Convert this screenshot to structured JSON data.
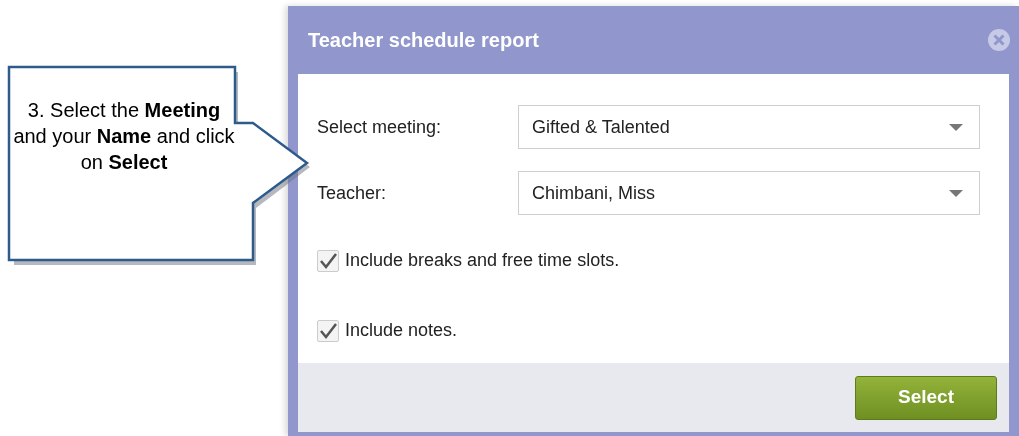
{
  "callout": {
    "text": "3. Select the **Meeting** and your **Name** and click on **Select**"
  },
  "dialog": {
    "title": "Teacher schedule report",
    "fields": [
      {
        "label": "Select meeting:",
        "value": "Gifted & Talented"
      },
      {
        "label": "Teacher:",
        "value": "Chimbani, Miss"
      }
    ],
    "options": [
      {
        "label": "Include breaks and free time slots.",
        "checked": true
      },
      {
        "label": "Include notes.",
        "checked": true
      }
    ],
    "buttons": [
      "Select"
    ]
  }
}
